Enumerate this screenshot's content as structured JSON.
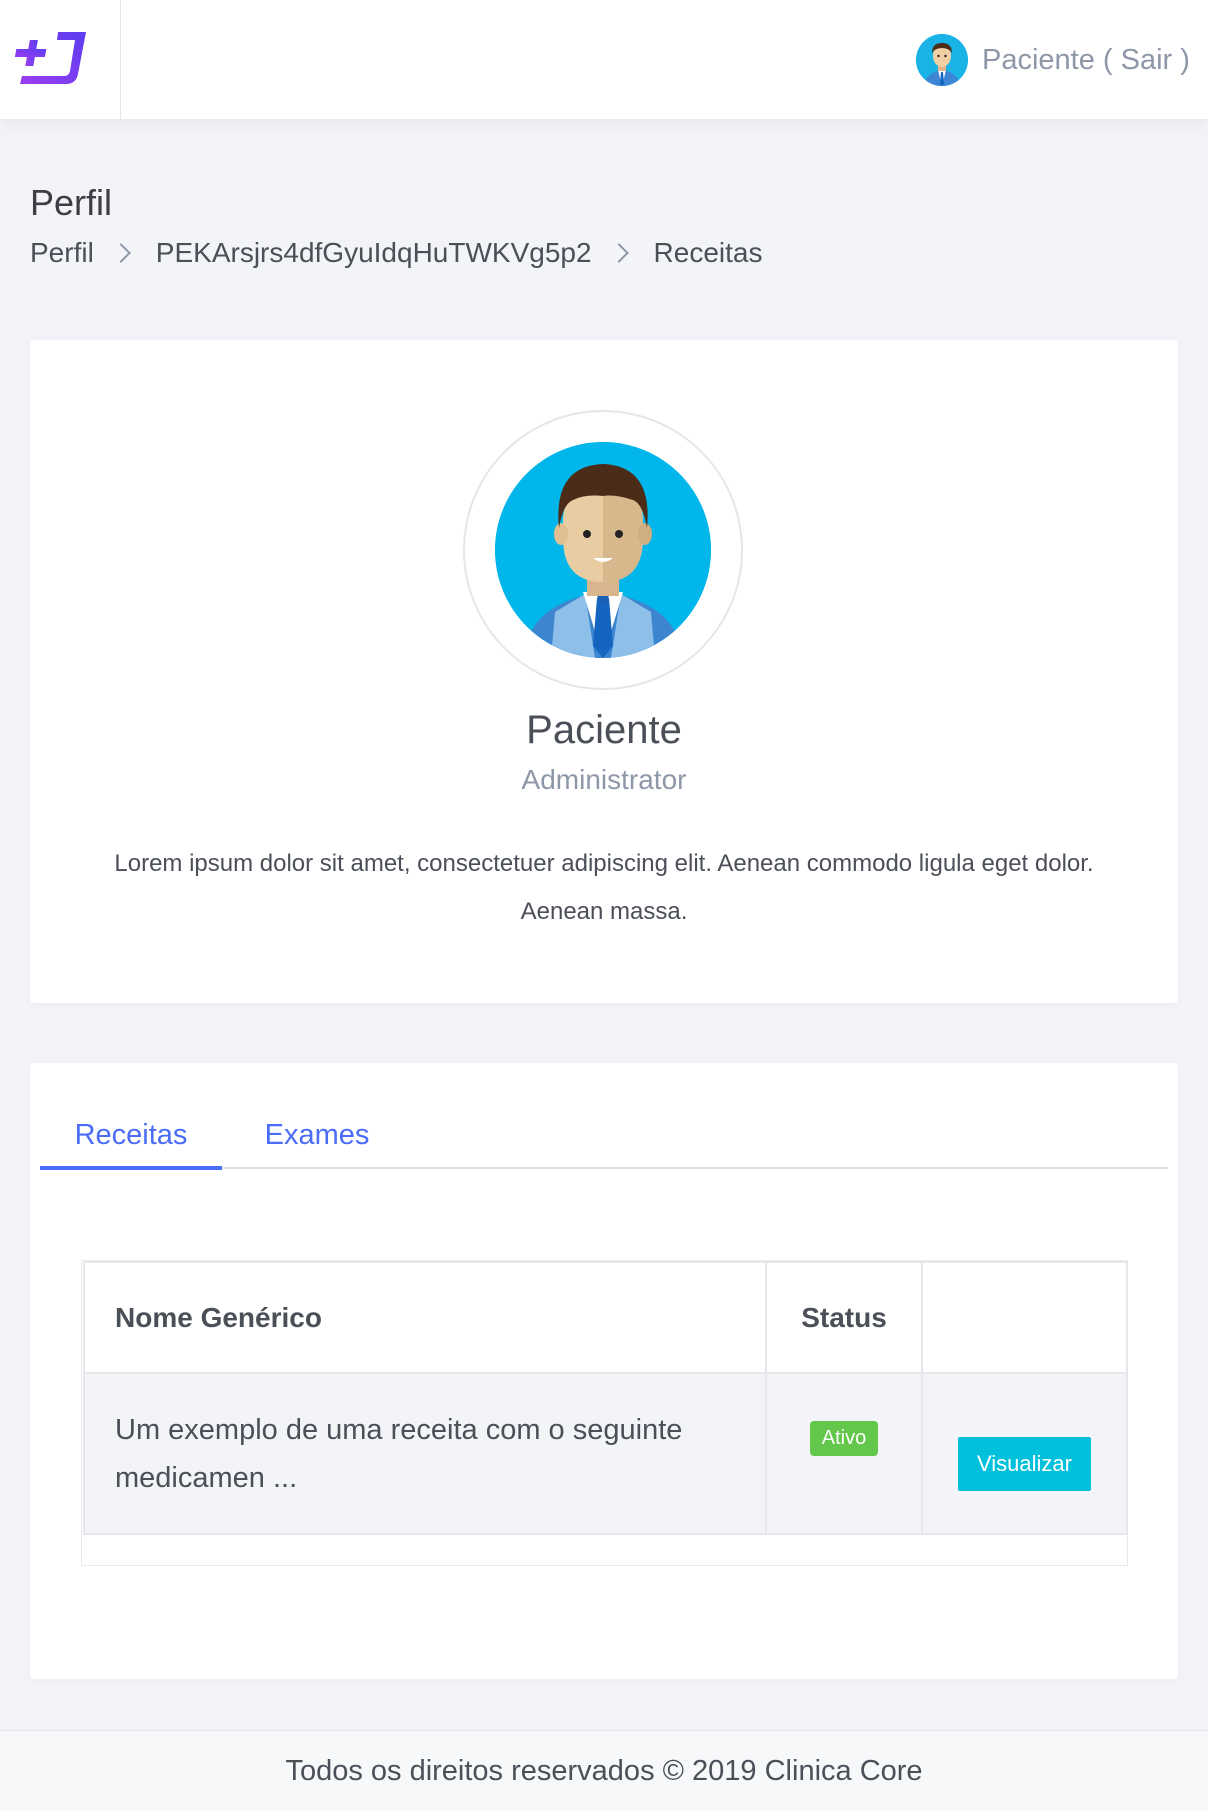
{
  "header": {
    "logo_icon": "plus-j-logo-icon",
    "user_label": "Paciente ( Sair )",
    "user_avatar_icon": "user-avatar-icon",
    "brand_color": "#7c3aed"
  },
  "page": {
    "title": "Perfil",
    "breadcrumb": [
      "Perfil",
      "PEKArsjrs4dfGyuIdqHuTWKVg5p2",
      "Receitas"
    ]
  },
  "profile": {
    "name": "Paciente",
    "role": "Administrator",
    "description": "Lorem ipsum dolor sit amet, consectetuer adipiscing elit. Aenean commodo ligula eget dolor. Aenean massa."
  },
  "tabs": [
    {
      "label": "Receitas",
      "active": true
    },
    {
      "label": "Exames",
      "active": false
    }
  ],
  "table": {
    "headers": [
      "Nome Genérico",
      "Status",
      ""
    ],
    "rows": [
      {
        "name": "Um exemplo de uma receita com o seguinte medicamen ...",
        "status": "Ativo",
        "action": "Visualizar"
      }
    ]
  },
  "colors": {
    "accent": "#4a6cf7",
    "status_active": "#62c74a",
    "button": "#00c0dc"
  },
  "footer": {
    "text": "Todos os direitos reservados © 2019 Clinica Core"
  }
}
